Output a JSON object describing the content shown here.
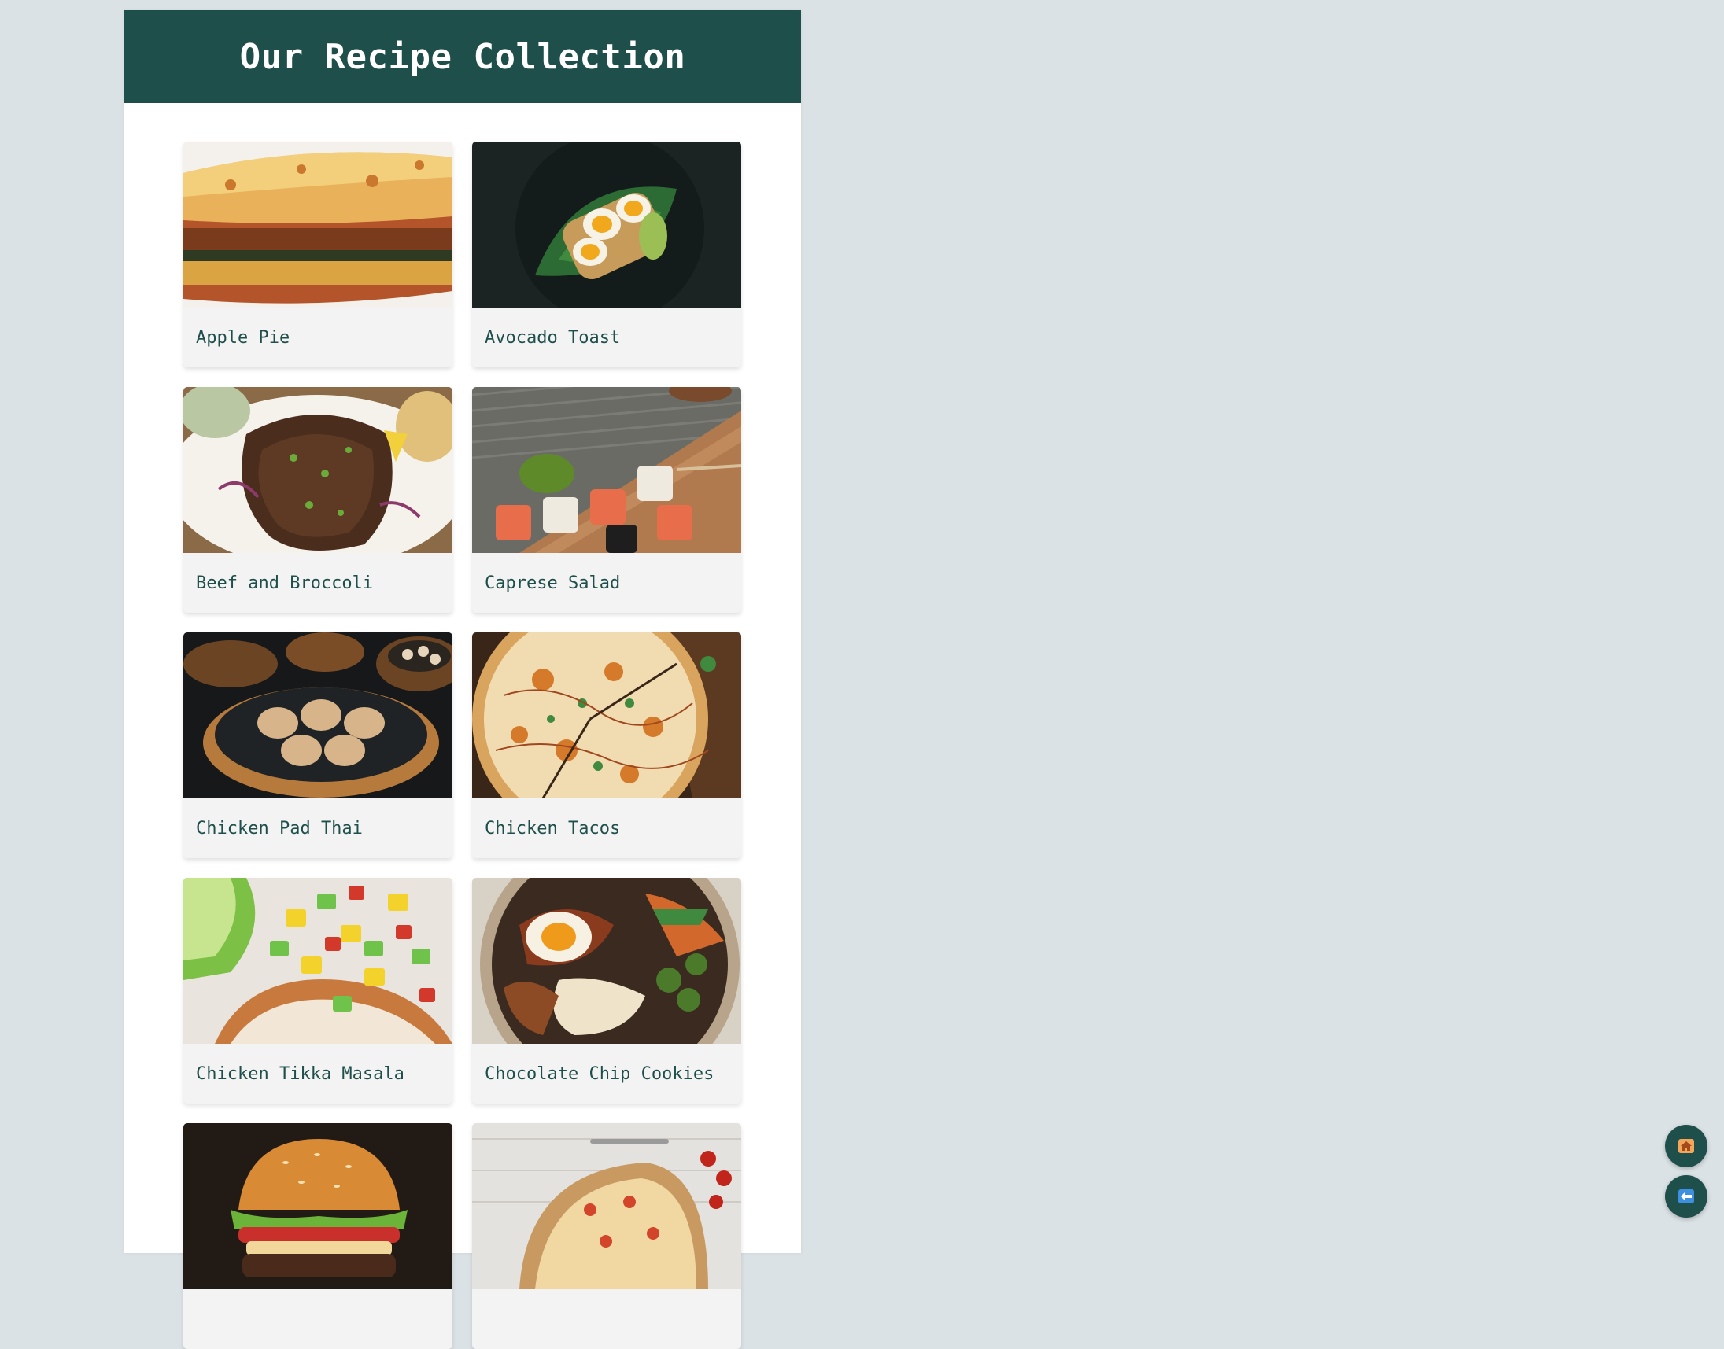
{
  "header": {
    "title": "Our Recipe Collection"
  },
  "recipes": [
    {
      "title": "Apple Pie",
      "photo": "moussaka-casserole"
    },
    {
      "title": "Avocado Toast",
      "photo": "egg-avocado-plate"
    },
    {
      "title": "Beef and Broccoli",
      "photo": "grilled-meat-platter"
    },
    {
      "title": "Caprese Salad",
      "photo": "sushi-rolls-board"
    },
    {
      "title": "Chicken Pad Thai",
      "photo": "dumplings-steamer"
    },
    {
      "title": "Chicken Tacos",
      "photo": "sliced-pizza"
    },
    {
      "title": "Chicken Tikka Masala",
      "photo": "grilled-chicken-salsa"
    },
    {
      "title": "Chocolate Chip Cookies",
      "photo": "bibimbap-bowl"
    },
    {
      "title": "",
      "photo": "burger"
    },
    {
      "title": "",
      "photo": "flatbread-pizza"
    }
  ],
  "fabs": {
    "home_icon": "house-icon",
    "back_icon": "back-arrow-icon"
  },
  "colors": {
    "brand": "#1f4f4b",
    "page_bg": "#dbe2e6",
    "card_bg": "#f3f3f3"
  }
}
